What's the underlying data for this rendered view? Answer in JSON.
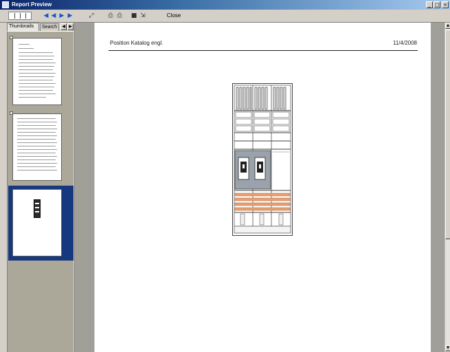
{
  "window": {
    "title": "Report Preview",
    "controls": {
      "minimize": "_",
      "maximize": "□",
      "close": "×"
    }
  },
  "toolbar": {
    "close_label": "Close",
    "icons": [
      {
        "name": "first-page-icon",
        "glyph": "◀"
      },
      {
        "name": "previous-page-icon",
        "glyph": "◀"
      },
      {
        "name": "next-page-icon",
        "glyph": "▶"
      },
      {
        "name": "last-page-icon",
        "glyph": "▶"
      },
      {
        "name": "zoom-icon",
        "glyph": "⤢"
      },
      {
        "name": "print-icon",
        "glyph": "⎙"
      },
      {
        "name": "print-setup-icon",
        "glyph": "⎙"
      },
      {
        "name": "save-icon",
        "glyph": "■"
      },
      {
        "name": "export-icon",
        "glyph": "⇲"
      }
    ]
  },
  "sidebar": {
    "tabs": [
      {
        "label": "Thumbnails",
        "active": true
      },
      {
        "label": "Search",
        "active": false
      }
    ],
    "tab_scroll": {
      "prev": "◀",
      "next": "▶"
    },
    "thumbnails": [
      {
        "page": 1,
        "selected": false
      },
      {
        "page": 2,
        "selected": false
      },
      {
        "page": 3,
        "selected": true
      }
    ]
  },
  "document": {
    "header_left": "Position Katalog engl.",
    "header_right": "11/4/2008",
    "figure": "switchgear-cabinet-drawing"
  },
  "scrollbar": {
    "up": "▲",
    "down": "▼"
  },
  "colors": {
    "title_bar": "#0a246a",
    "selected_thumbnail": "#16387e",
    "busbar_orange": "#e8a070",
    "breaker_fill": "#9aa3ac"
  }
}
